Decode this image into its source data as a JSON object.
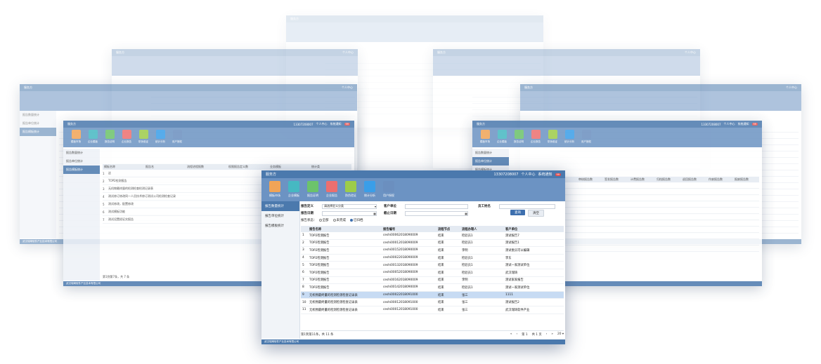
{
  "app": {
    "title": "服务方",
    "phone": "13307208007",
    "user_center": "个人中心",
    "message": "系统通知",
    "message_count": "99",
    "footer": "武汉瑞琦软件产业技术有限公司"
  },
  "toolbar": [
    {
      "label": "模板市场",
      "color": "#f0a457",
      "icon": "template-icon"
    },
    {
      "label": "企业模板",
      "color": "#46b8c2",
      "icon": "book-icon"
    },
    {
      "label": "报告证明",
      "color": "#6cc36b",
      "icon": "edit-icon"
    },
    {
      "label": "企业报告",
      "color": "#ec6f6f",
      "icon": "document-icon"
    },
    {
      "label": "防伪验证",
      "color": "#9dcc4a",
      "icon": "shield-icon"
    },
    {
      "label": "统计分析",
      "color": "#3a9ee8",
      "icon": "chart-icon"
    },
    {
      "label": "用户授权",
      "color": "#6b8fbf",
      "icon": "authorize-icon"
    }
  ],
  "sidebar": [
    {
      "label": "报告数量统计",
      "active": true
    },
    {
      "label": "报告单位统计",
      "active": false
    },
    {
      "label": "报告模板统计",
      "active": false
    }
  ],
  "filters": {
    "report_def_label": "报告定义",
    "report_def_value": "请选择定义分类",
    "client_label": "客户单位",
    "staff_label": "员工姓名",
    "report_date_label": "报告日期",
    "end_date_label": "截止日期",
    "status_label": "报告状态：",
    "status_options": [
      {
        "label": "全部",
        "checked": false
      },
      {
        "label": "未完成",
        "checked": false
      },
      {
        "label": "已归档",
        "checked": true
      }
    ],
    "search_button": "查询",
    "clear_button": "清空"
  },
  "table": {
    "headers": [
      "",
      "报告名称",
      "报告编号",
      "流程节点",
      "流程办理人",
      "客户单位"
    ],
    "rows": [
      [
        "1",
        "TOP2检测报告",
        "ceshi00062018090009",
        "结束",
        "检验员1",
        "测试报告7"
      ],
      [
        "2",
        "TOP2检测报告",
        "ceshi00012018090009",
        "结束",
        "检验员1",
        "测试报告1"
      ],
      [
        "3",
        "TOP2检测报告",
        "ceshi00152018090009",
        "结束",
        "李明",
        "测试委员可以编辑"
      ],
      [
        "4",
        "TOP2检测报告",
        "ceshi00022018090009",
        "结束",
        "检验员1",
        "李东"
      ],
      [
        "5",
        "TOP2检测报告",
        "ceshi00132018090009",
        "结束",
        "检验员1",
        "测试一家测试单位"
      ],
      [
        "6",
        "TOP2检测报告",
        "ceshi00052018090009",
        "结束",
        "检验员1",
        "武汉瑞琦"
      ],
      [
        "7",
        "TOP2检测报告",
        "ceshi00162018090009",
        "结束",
        "李明",
        "测试家家报告"
      ],
      [
        "8",
        "TOP2检测报告",
        "ceshi00142018090009",
        "结束",
        "检验员1",
        "测试一家测试单位"
      ],
      [
        "9",
        "无机物最终量的检测检测检查记录表",
        "ceshi00022018091000",
        "结束",
        "张三",
        "1111"
      ],
      [
        "10",
        "无机物最终量的检测检测检查记录表",
        "ceshi00012018091000",
        "结束",
        "张三",
        "测试报告2"
      ],
      [
        "11",
        "无机物最终量的检测检测检查记录表",
        "ceshi00012018091000",
        "结束",
        "张三",
        "武汉瑞琦软件产业"
      ]
    ],
    "selected_index": 8
  },
  "pager": {
    "summary": "第1到第11条，共 11 条",
    "page": "第 1",
    "total": "共 1 页",
    "page_size": "20"
  },
  "bg_windows": {
    "left_sidebar": [
      "报告数量统计",
      "报告单位统计",
      "报告模板统计"
    ],
    "left_rows": [
      "这",
      "TOP2检测报告",
      "无机物最终量的检测检查检测记录表",
      "测试修订修改同一人员技术修订测试公司检测检查记录",
      "测试修改，配置修改",
      "测试模板功能",
      "测试设置经证实报告"
    ],
    "left_headers": [
      "模板名称",
      "报告名",
      "流程进程报数",
      "权限报告定义数",
      "业务模板",
      "统计类"
    ],
    "right_headers": [
      "统计数",
      "审核报告数",
      "签发报告数",
      "计费报告数",
      "归档报告数",
      "退回报告数",
      "作废报告数",
      "报废报告数"
    ],
    "left_pager": "第1到第7条，共 7 条"
  }
}
